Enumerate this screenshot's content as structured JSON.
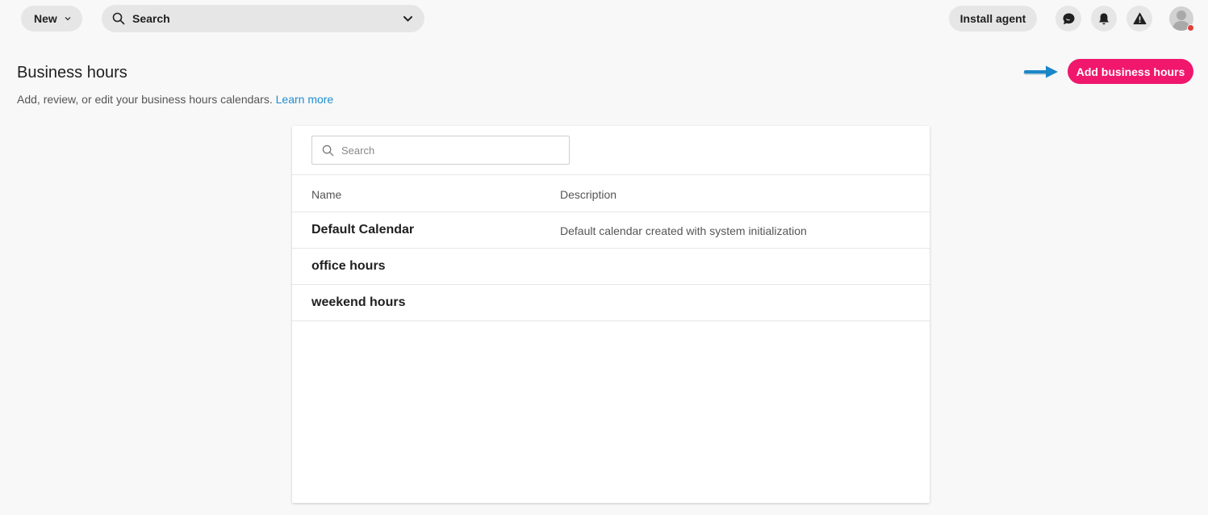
{
  "topbar": {
    "new_label": "New",
    "search_label": "Search",
    "install_label": "Install agent"
  },
  "header": {
    "title": "Business hours",
    "subtitle": "Add, review, or edit your business hours calendars.",
    "learn_more": "Learn more",
    "add_button": "Add business hours"
  },
  "panel": {
    "search_placeholder": "Search",
    "columns": [
      "Name",
      "Description"
    ],
    "rows": [
      {
        "name": "Default Calendar",
        "description": "Default calendar created with system initialization"
      },
      {
        "name": "office hours",
        "description": ""
      },
      {
        "name": "weekend hours",
        "description": ""
      }
    ]
  },
  "colors": {
    "accent": "#f0176d",
    "link": "#1f8ed0",
    "arrow": "#1b86c8",
    "status_dot": "#e0403c"
  }
}
